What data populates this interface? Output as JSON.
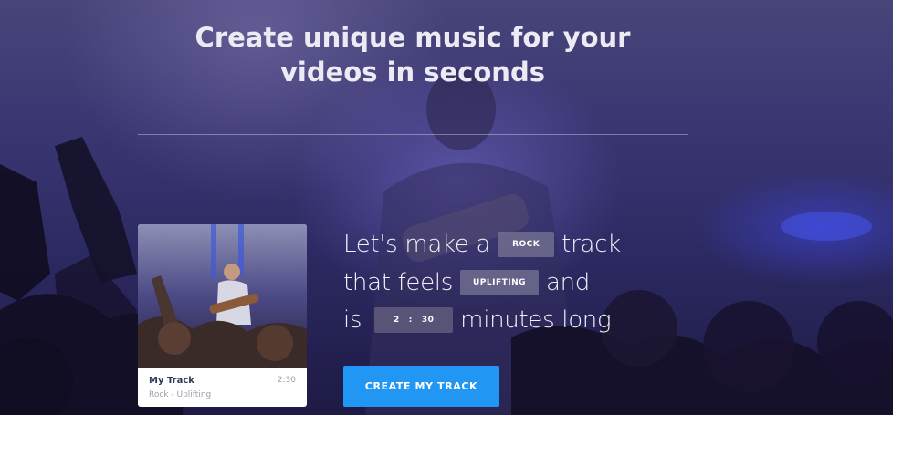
{
  "hero": {
    "headline_line1": "Create unique music for your",
    "headline_line2": "videos in seconds"
  },
  "sentence": {
    "line1_prefix": "Let's make a",
    "line1_suffix": "track",
    "line2_prefix": "that feels",
    "line2_suffix": "and",
    "line3_prefix": "is",
    "line3_suffix": "minutes long"
  },
  "selectors": {
    "genre": "ROCK",
    "mood": "UPLIFTING",
    "minutes": "2",
    "separator": ":",
    "seconds": "30"
  },
  "track_card": {
    "title": "My Track",
    "subtitle": "Rock - Uplifting",
    "duration": "2:30"
  },
  "cta": {
    "label": "CREATE MY TRACK",
    "color": "#2196f3"
  }
}
